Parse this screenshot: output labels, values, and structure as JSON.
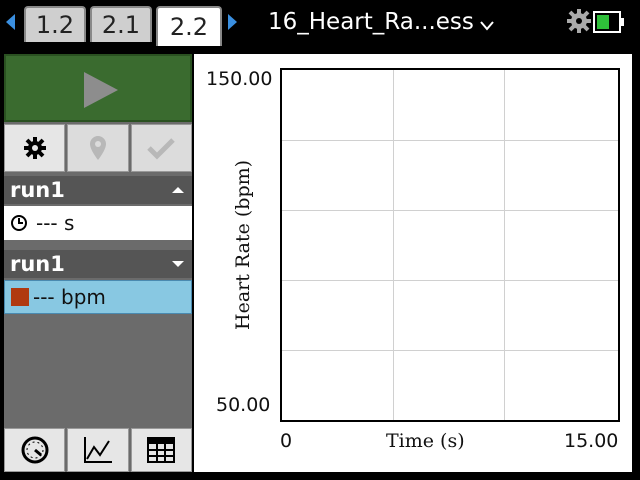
{
  "tabs": [
    {
      "label": "1.2"
    },
    {
      "label": "2.1"
    },
    {
      "label": "2.2"
    }
  ],
  "document": {
    "title": "16_Heart_Ra...ess"
  },
  "left_panel": {
    "run1_header_a": "run1",
    "time_row": {
      "value": "--- s"
    },
    "run1_header_b": "run1",
    "hr_row": {
      "value": "--- bpm",
      "swatch_color": "#b03a10"
    }
  },
  "graph": {
    "y_max": "150.00",
    "y_min": "50.00",
    "x_min": "0",
    "x_max": "15.00",
    "x_title": "Time (s)",
    "y_title": "Heart Rate (bpm)"
  },
  "colors": {
    "accent_blue": "#3a8fe0",
    "play_green": "#3a6b2f",
    "selected_row": "#88c8e2"
  }
}
